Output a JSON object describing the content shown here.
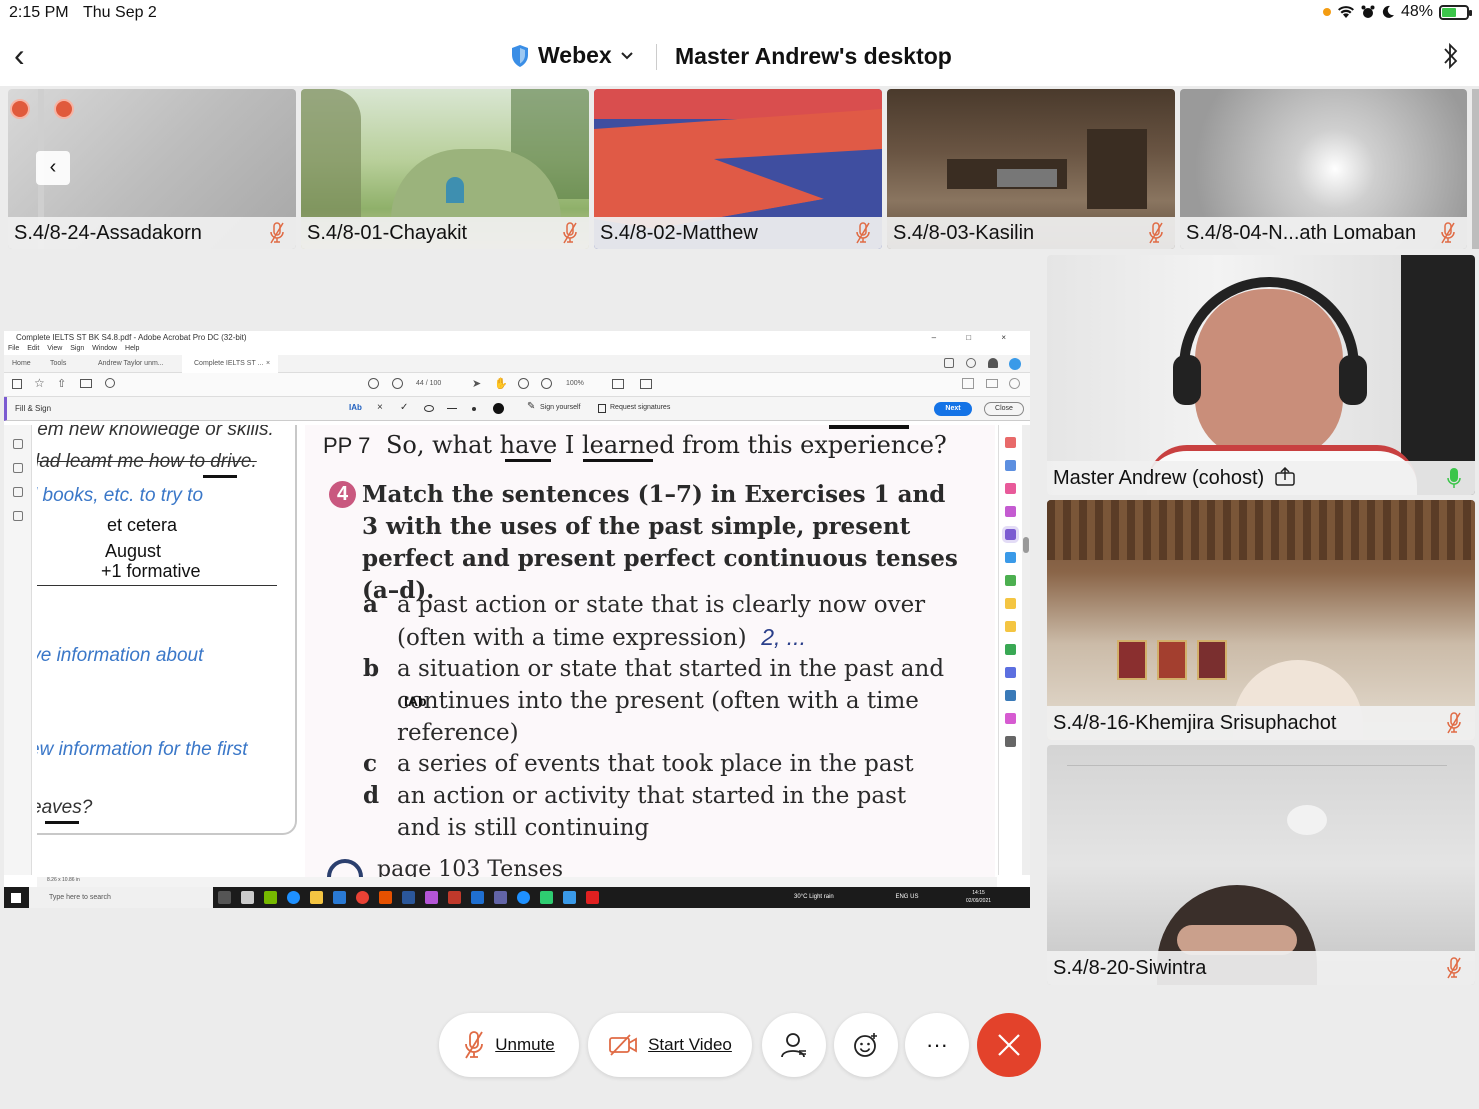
{
  "status_bar": {
    "time": "2:15 PM",
    "date": "Thu Sep 2",
    "battery": "48%"
  },
  "header": {
    "app_name": "Webex",
    "title": "Master Andrew's desktop"
  },
  "participants_strip": [
    {
      "name": "S.4/8-24-Assadakorn",
      "muted": true
    },
    {
      "name": "S.4/8-01-Chayakit",
      "muted": true
    },
    {
      "name": "S.4/8-02-Matthew",
      "muted": true
    },
    {
      "name": "S.4/8-03-Kasilin",
      "muted": true
    },
    {
      "name": "S.4/8-04-N...ath Lomaban",
      "muted": true
    }
  ],
  "side_videos": [
    {
      "name": "Master Andrew (cohost)",
      "muted": false
    },
    {
      "name": "S.4/8-16-Khemjira Srisuphachot",
      "muted": true
    },
    {
      "name": "S.4/8-20-Siwintra",
      "muted": true
    }
  ],
  "shared_screen": {
    "window_title": "Complete IELTS ST BK S4.8.pdf - Adobe Acrobat Pro DC (32-bit)",
    "menu": "File   Edit   View   Sign   Window   Help",
    "tabs": [
      "Home",
      "Tools",
      "Andrew Taylor unm...",
      "Complete IELTS ST ..."
    ],
    "page_indicator": "44 / 100",
    "zoom": "100%",
    "fill_sign_label": "Fill & Sign",
    "sign_yourself": "Sign yourself",
    "request_signatures": "Request signatures",
    "next_label": "Next",
    "close_label": "Close",
    "page_size": "8.26 x 10.86 in",
    "prev_page_lines": [
      "lem new knowledge or skills.",
      "lad leamt me how to drive.",
      "l books, etc. to try to",
      "ive information about",
      "ew information for the first",
      "eaves?"
    ],
    "handwritten_notes": [
      "et cetera",
      "August",
      "+1 formative"
    ],
    "q7_num": "PP 7",
    "q7_text": "So, what have I learned from this experience?",
    "exercise_number": "4",
    "exercise_instruction": "Match the sentences (1–7) in Exercises 1 and 3 with the uses of the past simple, present perfect and present perfect continuous tenses (a–d).",
    "options": [
      {
        "letter": "a",
        "text": "a past action or state that is clearly now over (often with a time expression)",
        "note": "2, ..."
      },
      {
        "letter": "b",
        "text": "a situation or state that started in the past and continues into the present (often with a time reference)",
        "note": ""
      },
      {
        "letter": "c",
        "text": "a series of events that took place in the past",
        "note": ""
      },
      {
        "letter": "d",
        "text": "an action or activity that started in the past and is still continuing",
        "note": ""
      }
    ],
    "footer_partial": "page 103 Tenses",
    "taskbar_search": "Type here to search",
    "weather": "30°C  Light rain",
    "lang": "ENG US",
    "clock_time": "14:15",
    "clock_date": "02/09/2021"
  },
  "controls": {
    "unmute_label": "Unmute",
    "start_video_label": "Start Video"
  },
  "colors": {
    "end_call": "#e3422b",
    "muted_mic": "#e06b45",
    "live_mic": "#3cc54a",
    "fill_sign_accent": "#7b5bd1",
    "acrobat_next": "#1473e6"
  }
}
